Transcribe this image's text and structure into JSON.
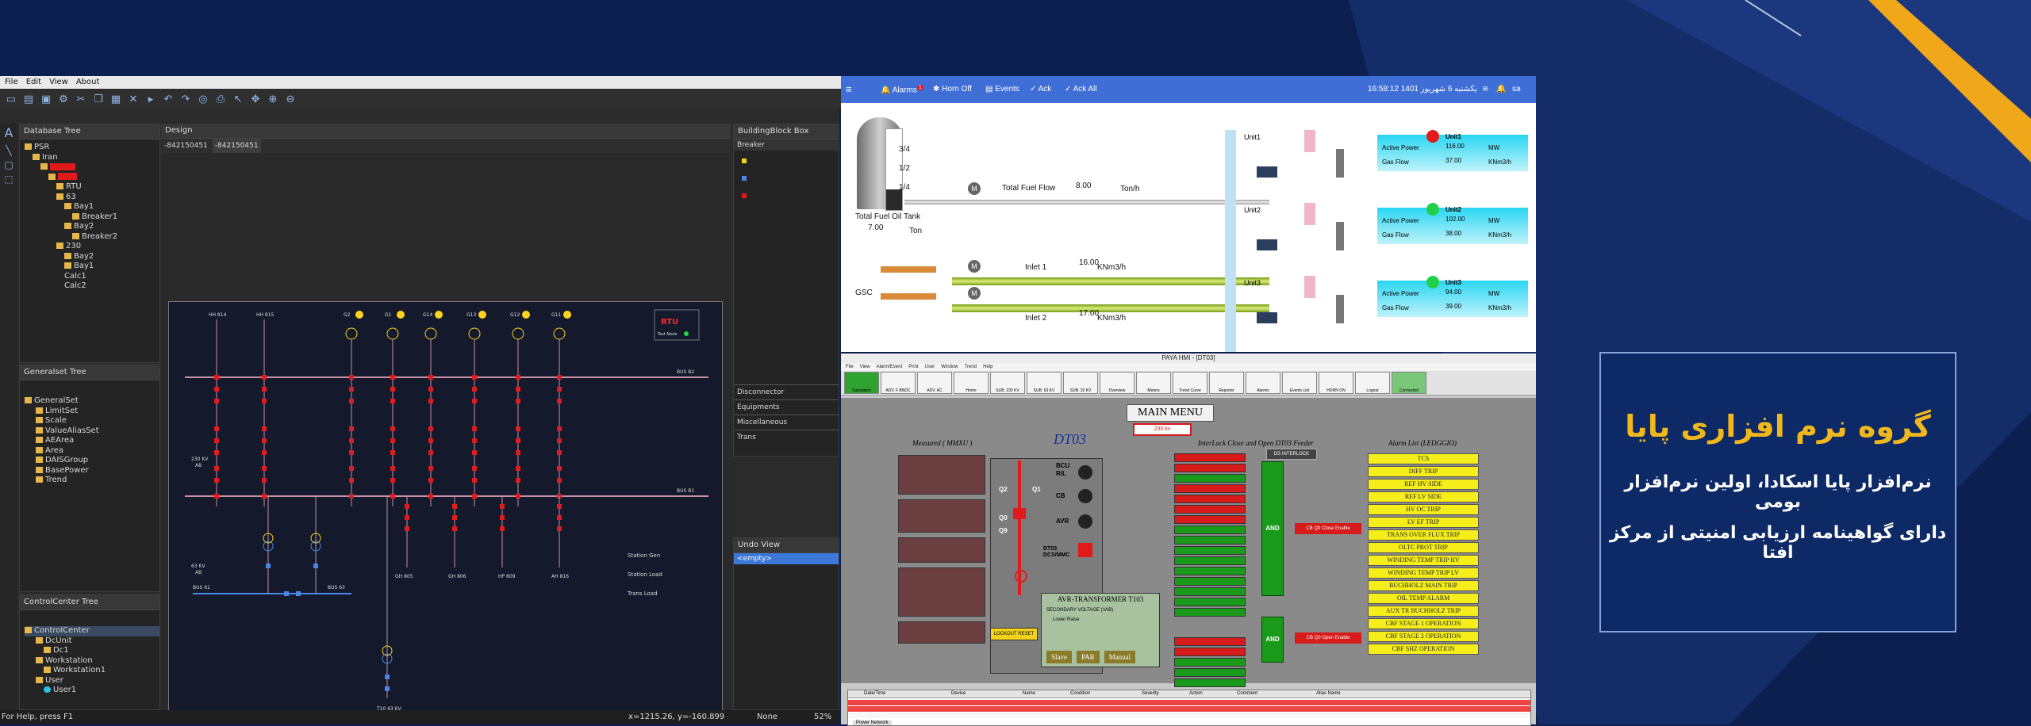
{
  "designer": {
    "menu": [
      "File",
      "Edit",
      "View",
      "About"
    ],
    "panels": {
      "database_tree": "Database Tree",
      "generalset_tree": "Generalset Tree",
      "controlcenter_tree": "ControlCenter Tree",
      "design": "Design",
      "buildingblock_box": "BuildingBlock Box",
      "undo_view": "Undo View"
    },
    "tabs": [
      "-842150451",
      "-842150451"
    ],
    "database_tree_items": [
      "PSR",
      "Iran",
      "RTU",
      "63",
      "Bay1",
      "Breaker1",
      "Bay2",
      "Breaker2",
      "230",
      "Bay2",
      "Bay1",
      "Calc1",
      "Calc2"
    ],
    "generalset_items": [
      "GeneralSet",
      "LimitSet",
      "Scale",
      "ValueAliasSet",
      "AEArea",
      "Area",
      "DAISGroup",
      "BasePower",
      "Trend"
    ],
    "controlcenter_items": [
      "ControlCenter",
      "DcUnit",
      "Dc1",
      "Workstation",
      "Workstation1",
      "User",
      "User1"
    ],
    "buildingblock_selected": "Breaker",
    "buildingblock_sections": [
      "Disconnector",
      "Equipments",
      "Miscellaneous",
      "Trans"
    ],
    "undo_item": "<empty>",
    "status": {
      "help": "For Help, press F1",
      "coords": "x=1215.26, y=-160.899",
      "mode": "None",
      "zoom": "52%"
    },
    "diagram": {
      "rtu_label": "RTU",
      "rtu_sub": "Test Node",
      "bus_b2": "BUS B2",
      "bus_b1": "BUS B1",
      "bus_63": "BUS 63",
      "bus_61": "BUS 61",
      "v230": "230 KV",
      "v63": "63 KV",
      "ab": "AB",
      "feeders": [
        "HH 814",
        "HH 815",
        "G2",
        "G1",
        "G14",
        "G13",
        "G12",
        "G11"
      ],
      "station_gen": "Station Gen",
      "station_load": "Station Load",
      "trans_load": "Trans Load",
      "gh": [
        "GH 805",
        "GH 806",
        "HP 809",
        "AH 816"
      ],
      "t": "T10 63 KV"
    }
  },
  "hmi": {
    "alarms": "Alarms",
    "alarm_count": "1",
    "nav": [
      "Horn Off",
      "Events",
      "Ack",
      "Ack All"
    ],
    "datetime": "16:58:12 یکشنبه 6 شهریور 1401",
    "user": "sa",
    "tank_levels": [
      "3/4",
      "1/2",
      "1/4"
    ],
    "tank_label": "Total Fuel Oil Tank",
    "tank_value": "7.00",
    "tank_unit": "Ton",
    "fuel_flow_label": "Total Fuel Flow",
    "fuel_flow_value": "8.00",
    "fuel_flow_unit": "Ton/h",
    "gsc": "GSC",
    "inlet1_label": "Inlet 1",
    "inlet1_value": "16.00",
    "inlet2_label": "Inlet 2",
    "inlet2_value": "17.00",
    "flow_unit": "KNm3/h",
    "units": [
      {
        "name": "Unit1",
        "power": "116.00",
        "gas": "37.00",
        "status_color": "#e11b1b"
      },
      {
        "name": "Unit2",
        "power": "102.00",
        "gas": "38.00",
        "status_color": "#1fd14a"
      },
      {
        "name": "Unit3",
        "power": "94.00",
        "gas": "39.00",
        "status_color": "#1fd14a"
      }
    ],
    "active_power_label": "Active Power",
    "gas_flow_label": "Gas Flow",
    "mw": "MW",
    "knm": "KNm3/h"
  },
  "hmi2": {
    "title": "PAYA HMI - [DT03]",
    "menu": [
      "File",
      "View",
      "Alarm/Event",
      "Print",
      "User",
      "Window",
      "Trend",
      "Help"
    ],
    "toolbar": [
      "Substation",
      "ADV. F BNDC",
      "ADV. AC",
      "Home",
      "SUB. 230 KV",
      "SUB. 63 KV",
      "SUB. 20 KV",
      "Overview",
      "Meters",
      "Trend Curve",
      "Reporter",
      "Alarms",
      "Events List",
      "HORN ON",
      "Logout",
      "Connected"
    ],
    "main_menu": "MAIN MENU",
    "kv": "230 kv",
    "dt03": "DT03",
    "measured": "Measured ( MMXU )",
    "interlock": "InterLock Close and Open DT03 Feeder",
    "alarm_list": "Alarm List (LEDGGIO)",
    "ds_interlock": "DS INTERLOCK",
    "and": "AND",
    "cb_close": "CB Q0 Close Enable",
    "cb_open": "CB Q0 Open Enable",
    "bcu": "BCU",
    "rl": "R/L",
    "cb": "CB",
    "avr": "AVR",
    "dt03_mmc": "DT03 DCS/MMC",
    "q0": "Q0",
    "q1": "Q1",
    "q2": "Q2",
    "q9": "Q9",
    "avr_transformer": "AVR-TRANSFORMER T103",
    "secondary_voltage": "SECONDARY VOLTAGE (VAB)",
    "lower_raise": "Lower Raise",
    "lockout_reset": "LOCKOUT RESET",
    "buttons": [
      "Slave",
      "PAR",
      "Manual"
    ],
    "alarms": [
      "TCS",
      "DIFF TRIP",
      "REF HV SIDE",
      "REF LV SIDE",
      "HV OC TRIP",
      "LV EF TRIP",
      "TRANS OVER FLUX TRIP",
      "OLTC PROT TRIP",
      "WINDING TEMP TRIP HV",
      "WINDING TEMP TRIP LV",
      "BUCHHOLZ MAIN TRIP",
      "OIL TEMP ALARM",
      "AUX TR BUCHHOLZ TRIP",
      "CBF STAGE 1 OPERATION",
      "CBF STAGE 2 OPERATION",
      "CBF SHZ OPERATION"
    ],
    "table_headers": [
      "Date/Time",
      "Device",
      "Name",
      "Condition",
      "Severity",
      "Action",
      "Comment",
      "Alias Name"
    ],
    "footer_tab": "Power Network"
  },
  "info": {
    "title": "گروه نرم افزاری پایا",
    "line1": "نرم‌افزار پایا اسکادا، اولین نرم‌افزار بومی",
    "line2": "دارای گواهینامه ارزیابی امنیتی از مرکز افتا"
  },
  "colors": {
    "background": "#0d1f4e",
    "accent_gold": "#f2b81b",
    "hmi_bar": "#3f6fd6"
  }
}
